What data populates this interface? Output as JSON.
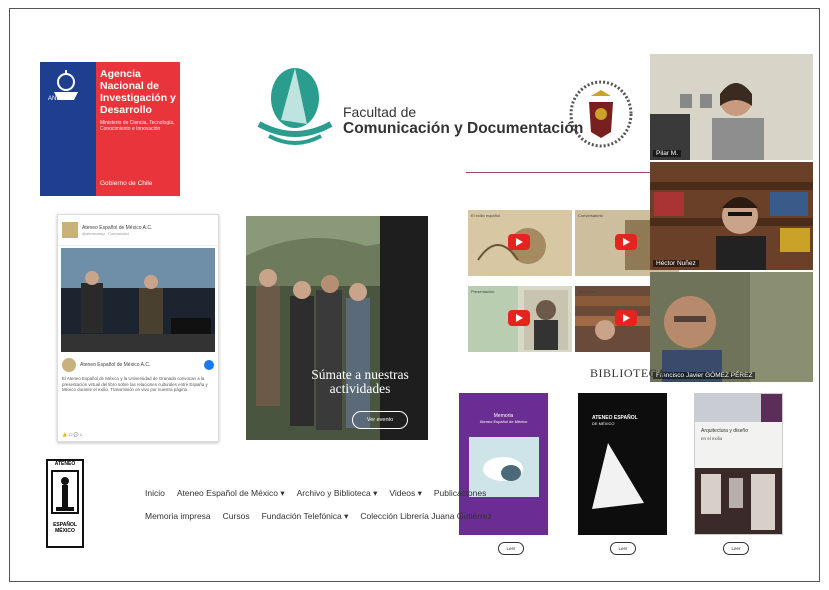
{
  "anid": {
    "title": "Agencia Nacional de Investigación y Desarrollo",
    "subtitle": "Ministerio de Ciencia, Tecnología, Conocimiento e Innovación",
    "gobierno": "Gobierno de Chile",
    "badge": "ANID"
  },
  "facultad": {
    "line1": "Facultad de",
    "line2": "Comunicación y Documentación"
  },
  "fb_post": {
    "page_name": "Ateneo Español de México A.C.",
    "handle": "@ateneoesp · Comunidad",
    "post_name": "Ateneo Español de México A.C.",
    "text": "El Ateneo Español de México y la Universidad de Granada convocan a la presentación virtual del libro sobre las relaciones culturales entre España y México durante el exilio. Transmisión en vivo por nuestra página.",
    "footer": "👍 12   💬 2"
  },
  "promo": {
    "headline": "Súmate a nuestras actividades",
    "button": "Ver evento"
  },
  "videos": [
    {
      "title": "El exilio español"
    },
    {
      "title": "Conversatorio"
    },
    {
      "title": "Presentación"
    },
    {
      "title": "Homenaje"
    }
  ],
  "call": {
    "participants": [
      {
        "name": "Pilar M."
      },
      {
        "name": "Héctor Nuñez"
      },
      {
        "name": "Francisco Javier GÓMEZ PÉREZ"
      }
    ]
  },
  "biblioteca": "BIBLIOTECA",
  "books": [
    {
      "title": "Memoria",
      "subtitle": "Ateneo Español de México",
      "button": "Leer"
    },
    {
      "title": "ATENEO ESPAÑOL",
      "subtitle": "DE MÉXICO",
      "button": "Leer"
    },
    {
      "title": "Arquitectura y diseño",
      "subtitle": "en el exilio",
      "button": "Leer"
    }
  ],
  "nav": {
    "row1": [
      "Inicio",
      "Ateneo Español de México ▾",
      "Archivo y Biblioteca ▾",
      "Videos ▾",
      "Publicaciones"
    ],
    "row2": [
      "Memoria impresa",
      "Cursos",
      "Fundación Telefónica ▾",
      "Colección Librería Juana Gutiérrez"
    ]
  },
  "ateneo_logo": {
    "top": "ATENEO",
    "bottom1": "ESPAÑOL",
    "bottom2": "MÉXICO"
  }
}
